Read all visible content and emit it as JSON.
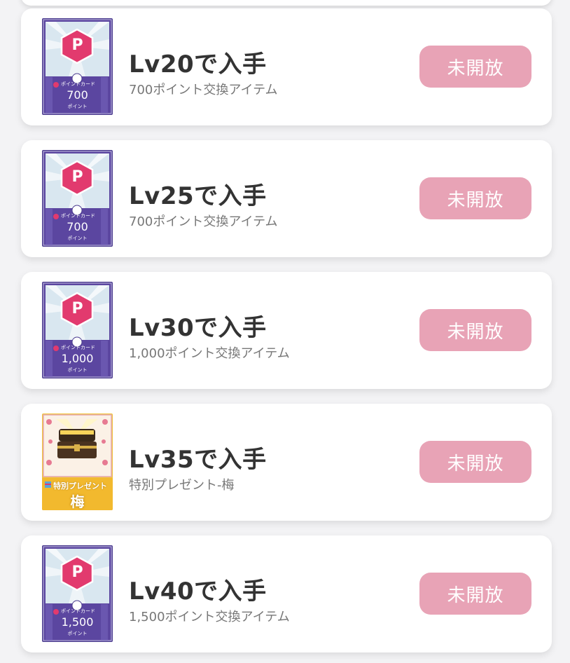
{
  "items": [
    {
      "title": "Lv20で入手",
      "subtitle": "700ポイント交換アイテム",
      "status": "未開放",
      "card_kind": "point",
      "card_label": "ポイントカード",
      "card_amount": "700",
      "card_unit": "ポイント",
      "badge_letter": "P"
    },
    {
      "title": "Lv25で入手",
      "subtitle": "700ポイント交換アイテム",
      "status": "未開放",
      "card_kind": "point",
      "card_label": "ポイントカード",
      "card_amount": "700",
      "card_unit": "ポイント",
      "badge_letter": "P"
    },
    {
      "title": "Lv30で入手",
      "subtitle": "1,000ポイント交換アイテム",
      "status": "未開放",
      "card_kind": "point",
      "card_label": "ポイントカード",
      "card_amount": "1,000",
      "card_unit": "ポイント",
      "badge_letter": "P"
    },
    {
      "title": "Lv35で入手",
      "subtitle": "特別プレゼント-梅",
      "status": "未開放",
      "card_kind": "present",
      "card_label": "特別プレゼント",
      "card_amount": "梅"
    },
    {
      "title": "Lv40で入手",
      "subtitle": "1,500ポイント交換アイテム",
      "status": "未開放",
      "card_kind": "point",
      "card_label": "ポイントカード",
      "card_amount": "1,500",
      "card_unit": "ポイント",
      "badge_letter": "P"
    }
  ],
  "colors": {
    "status_button": "#e8a3b6",
    "title": "#333333",
    "subtitle": "#777777",
    "card_purple": "#5b46a0",
    "badge_pink": "#e23a6e",
    "present_gold": "#f0c23c"
  }
}
